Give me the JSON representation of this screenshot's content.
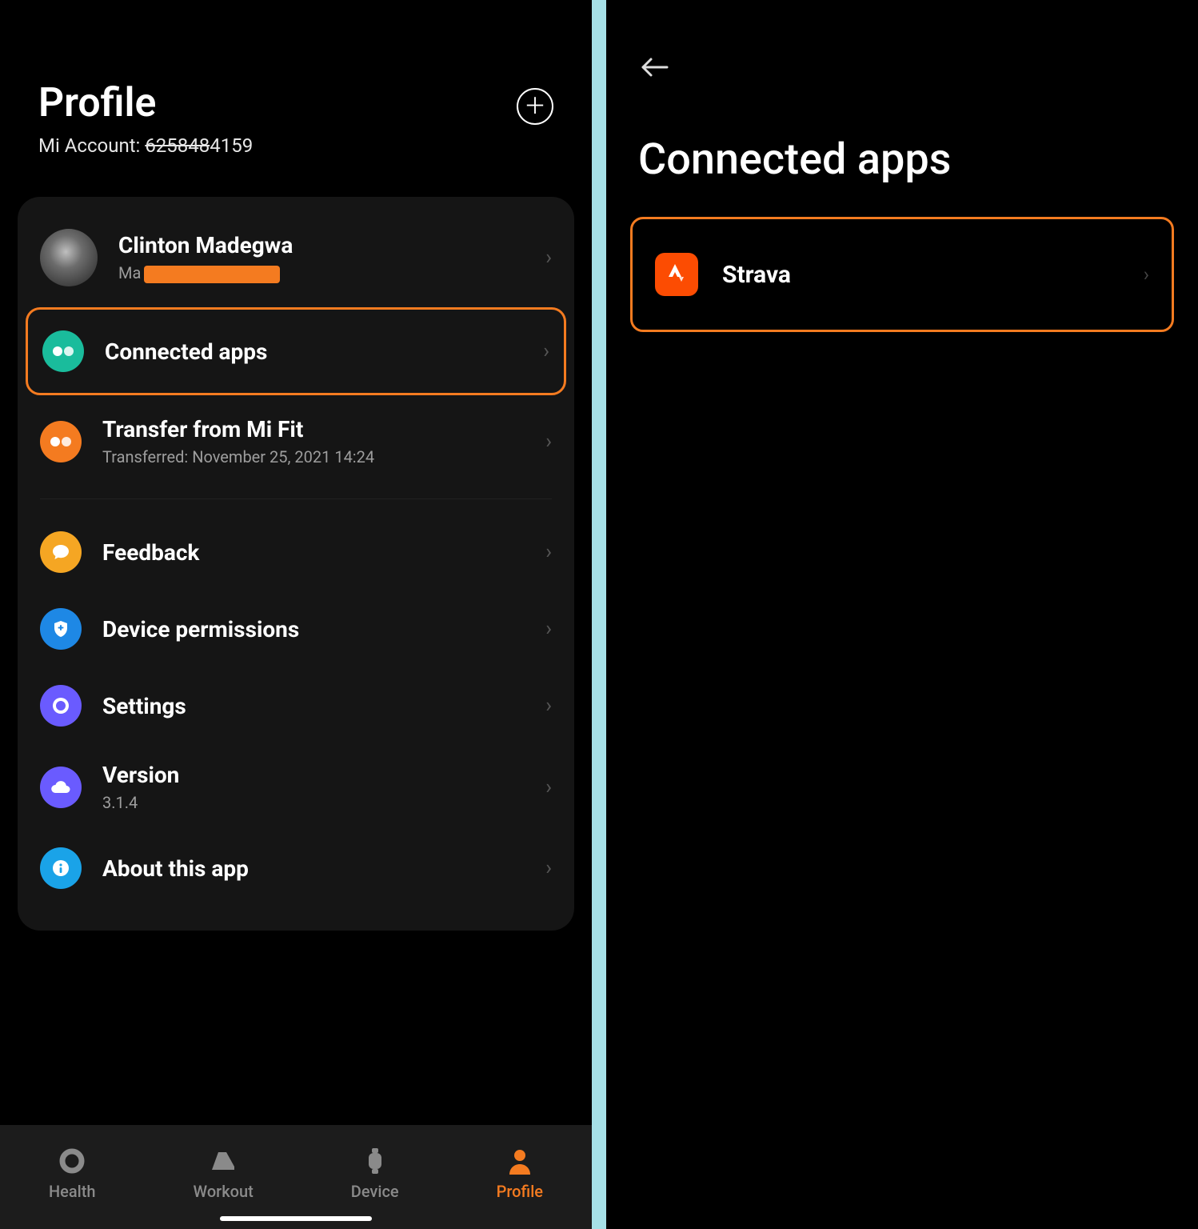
{
  "left": {
    "header": {
      "title": "Profile",
      "account_label": "Mi Account: ",
      "account_id_struck": "625848",
      "account_id_tail": "4159"
    },
    "user": {
      "name": "Clinton Madegwa",
      "sub_prefix": "Ma"
    },
    "rows": {
      "connected": {
        "label": "Connected apps"
      },
      "transfer": {
        "label": "Transfer from Mi Fit",
        "sub": "Transferred: November 25, 2021 14:24"
      },
      "feedback": {
        "label": "Feedback"
      },
      "perms": {
        "label": "Device permissions"
      },
      "settings": {
        "label": "Settings"
      },
      "version": {
        "label": "Version",
        "sub": "3.1.4"
      },
      "about": {
        "label": "About this app"
      }
    },
    "nav": {
      "health": "Health",
      "workout": "Workout",
      "device": "Device",
      "profile": "Profile"
    }
  },
  "right": {
    "title": "Connected apps",
    "apps": {
      "strava": {
        "name": "Strava"
      }
    }
  }
}
